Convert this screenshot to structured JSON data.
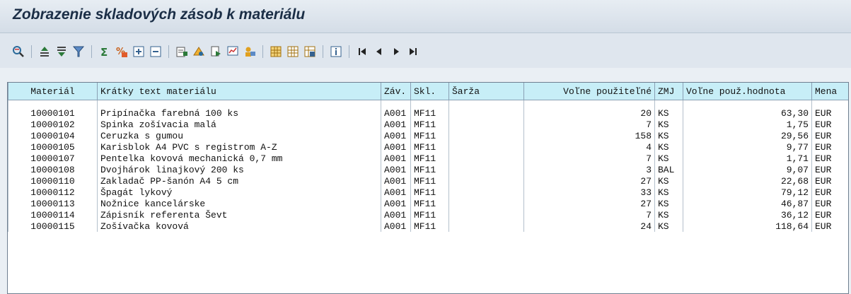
{
  "header": {
    "title": "Zobrazenie skladových zásob k materiálu"
  },
  "toolbar": {
    "groups": [
      [
        "details-icon"
      ],
      [
        "sort-ascending-icon",
        "sort-descending-icon",
        "filter-icon"
      ],
      [
        "total-icon",
        "subtotal-icon",
        "expand-icon",
        "collapse-icon"
      ],
      [
        "export-spreadsheet-icon",
        "abc-analysis-icon",
        "export-file-icon",
        "graphic-icon",
        "mail-recipient-icon"
      ],
      [
        "change-layout-icon",
        "select-layout-icon",
        "save-layout-icon"
      ],
      [
        "information-icon"
      ],
      [
        "first-page-icon",
        "previous-page-icon",
        "next-page-icon",
        "last-page-icon"
      ]
    ]
  },
  "table": {
    "columns": [
      "Materiál",
      "Krátky text materiálu",
      "Záv.",
      "Skl.",
      "Šarža",
      "Voľne použiteľné",
      "ZMJ",
      "Voľne použ.hodnota",
      "Mena"
    ],
    "rows": [
      [
        "10000101",
        "Pripínačka farebná 100 ks",
        "A001",
        "MF11",
        "",
        "20",
        "KS",
        "63,30",
        "EUR"
      ],
      [
        "10000102",
        "Spinka zošívacia malá",
        "A001",
        "MF11",
        "",
        "7",
        "KS",
        "1,75",
        "EUR"
      ],
      [
        "10000104",
        "Ceruzka s gumou",
        "A001",
        "MF11",
        "",
        "158",
        "KS",
        "29,56",
        "EUR"
      ],
      [
        "10000105",
        "Karisblok A4 PVC s registrom A-Z",
        "A001",
        "MF11",
        "",
        "4",
        "KS",
        "9,77",
        "EUR"
      ],
      [
        "10000107",
        "Pentelka kovová mechanická 0,7 mm",
        "A001",
        "MF11",
        "",
        "7",
        "KS",
        "1,71",
        "EUR"
      ],
      [
        "10000108",
        "Dvojhárok linajkový 200 ks",
        "A001",
        "MF11",
        "",
        "3",
        "BAL",
        "9,07",
        "EUR"
      ],
      [
        "10000110",
        "Zakladač PP-šanón A4 5 cm",
        "A001",
        "MF11",
        "",
        "27",
        "KS",
        "22,68",
        "EUR"
      ],
      [
        "10000112",
        "Špagát lykový",
        "A001",
        "MF11",
        "",
        "33",
        "KS",
        "79,12",
        "EUR"
      ],
      [
        "10000113",
        "Nožnice kancelárske",
        "A001",
        "MF11",
        "",
        "27",
        "KS",
        "46,87",
        "EUR"
      ],
      [
        "10000114",
        "Zápisník referenta Ševt",
        "A001",
        "MF11",
        "",
        "7",
        "KS",
        "36,12",
        "EUR"
      ],
      [
        "10000115",
        "Zošívačka kovová",
        "A001",
        "MF11",
        "",
        "24",
        "KS",
        "118,64",
        "EUR"
      ]
    ]
  }
}
